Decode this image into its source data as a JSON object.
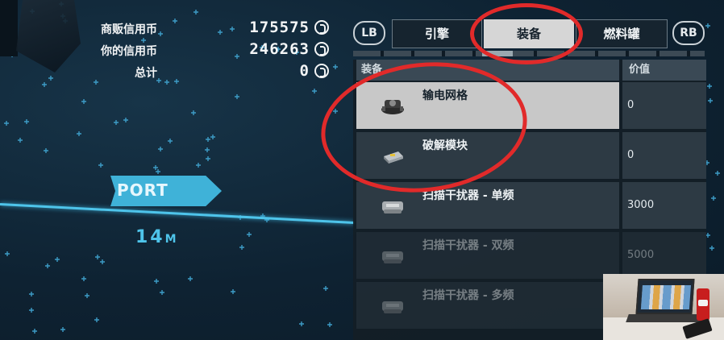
{
  "credits": {
    "vendor_label": "商贩信用币",
    "vendor_value": "175575",
    "player_label": "你的信用币",
    "player_value": "246263",
    "total_label": "总计",
    "total_value": "0"
  },
  "port": {
    "label": "PORT",
    "distance_value": "14",
    "distance_unit": "M"
  },
  "tabs": {
    "left_bumper": "LB",
    "right_bumper": "RB",
    "items": [
      "引擎",
      "装备",
      "燃料罐"
    ],
    "selected": "装备"
  },
  "shop": {
    "header_equipment": "装备",
    "header_price": "价值",
    "rows": [
      {
        "name": "输电网格",
        "price": "0",
        "state": "selected",
        "icon": "power-grid-icon"
      },
      {
        "name": "破解模块",
        "price": "0",
        "state": "normal",
        "icon": "hack-module-icon"
      },
      {
        "name": "扫描干扰器 - 单频",
        "price": "3000",
        "state": "normal",
        "icon": "scanner-jammer-icon"
      },
      {
        "name": "扫描干扰器 - 双频",
        "price": "5000",
        "state": "dim",
        "icon": "scanner-jammer-icon"
      },
      {
        "name": "扫描干扰器 - 多频",
        "price": "",
        "state": "dim",
        "icon": "scanner-jammer-icon"
      }
    ]
  },
  "colors": {
    "accent_cyan": "#4ec4ea",
    "annotation_red": "#e12a2a",
    "selected_row": "#c8c8c8",
    "panel_bg": "#2d3a44"
  }
}
